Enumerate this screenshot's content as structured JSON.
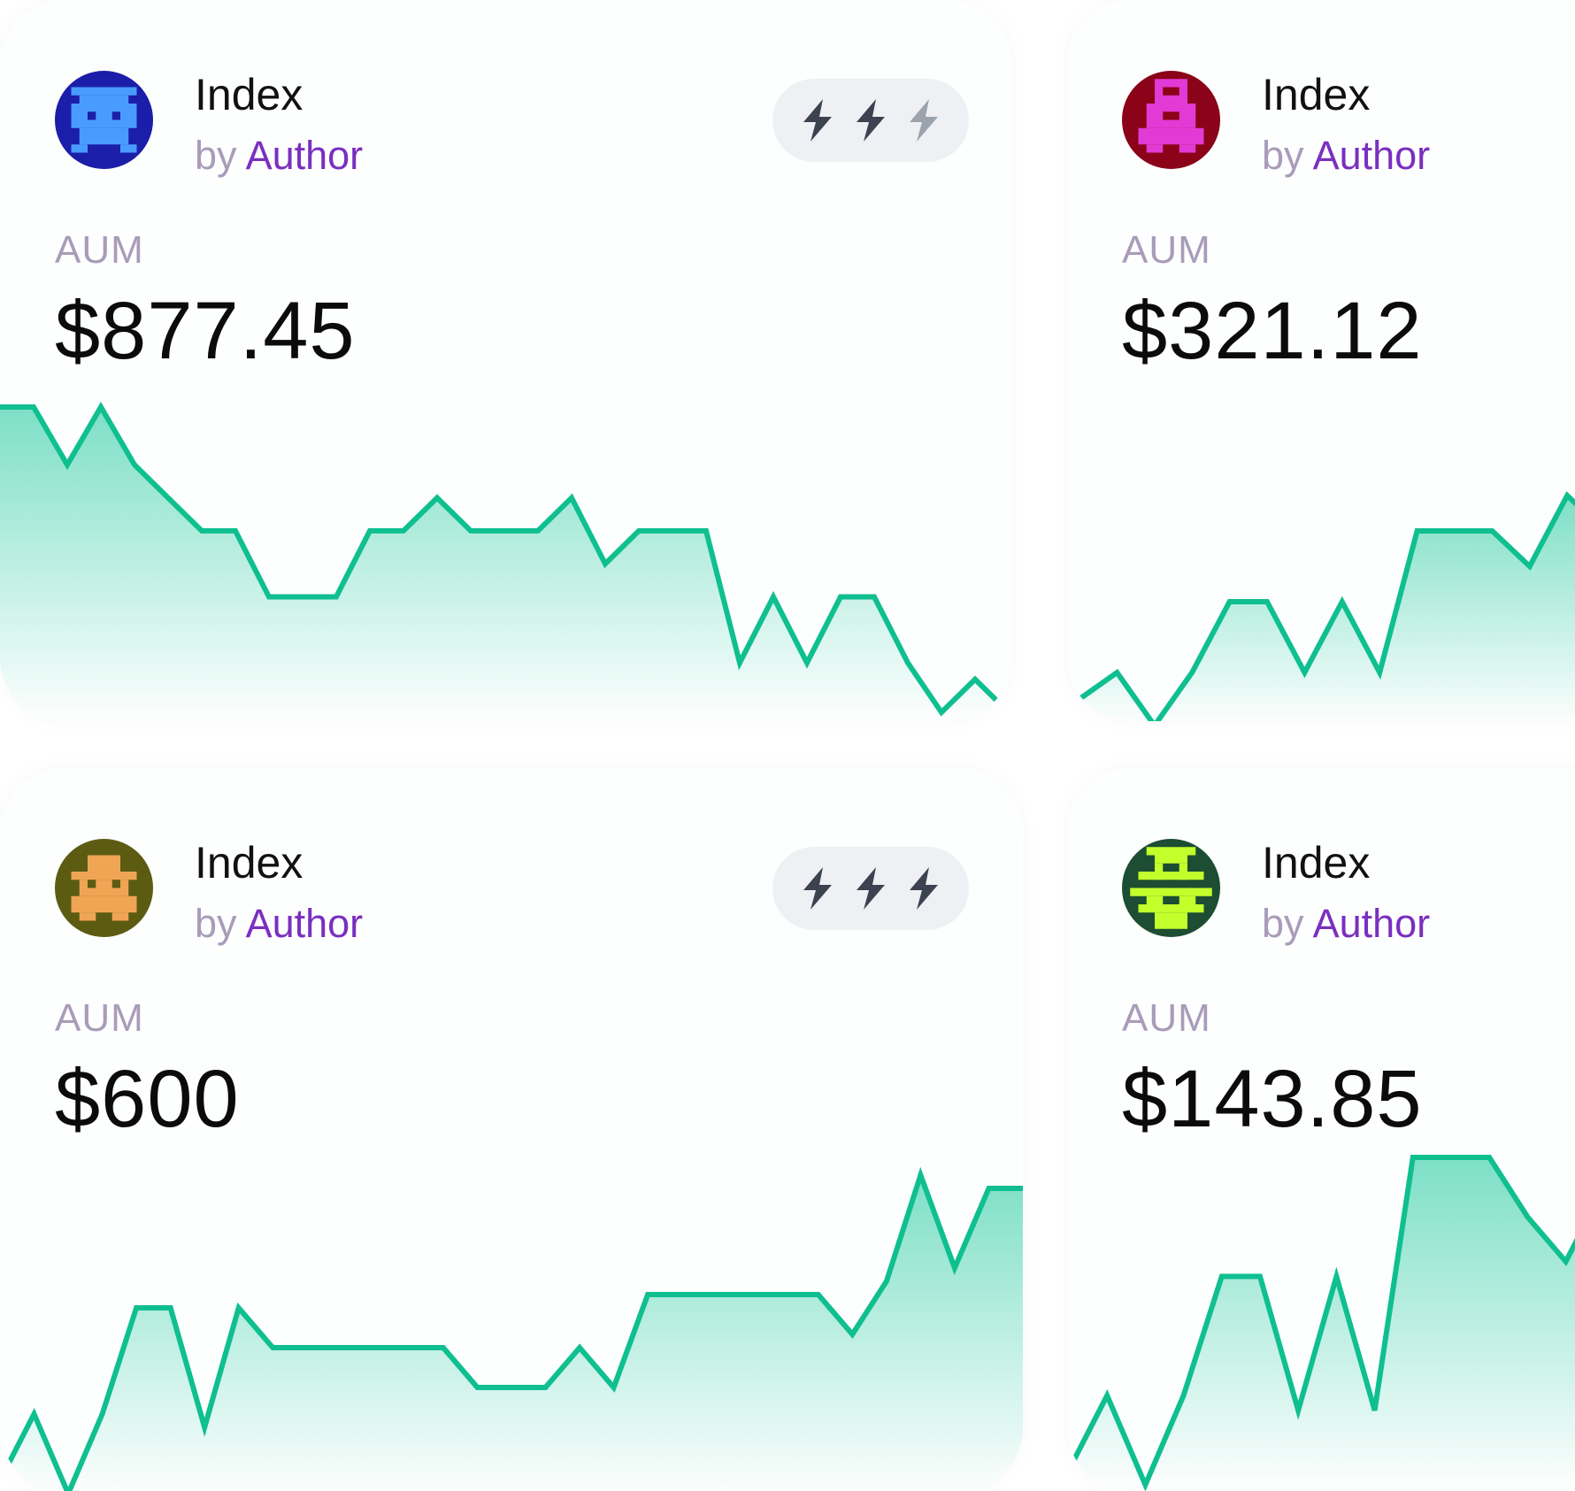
{
  "colors": {
    "accent_line": "#0fbf90",
    "accent_fill": "#6fdcc0",
    "author": "#7a2fc0",
    "muted_label": "#a99cb9",
    "badge_bg": "#eff0f4",
    "bolt_active": "#3d4250",
    "bolt_inactive": "#9ba3ad"
  },
  "cards": [
    {
      "title": "Index",
      "by": "by",
      "author": "Author",
      "aum_label": "AUM",
      "aum_value": "$877.45",
      "avatar_icon": "pixel-creature-blue-icon",
      "rating": {
        "filled": 2,
        "total": 3
      },
      "sparkline": [
        47,
        47,
        40,
        47,
        40,
        36,
        32,
        32,
        24,
        24,
        24,
        32,
        32,
        36,
        32,
        32,
        32,
        36,
        28,
        32,
        32,
        32,
        16,
        24,
        16,
        24,
        24,
        16,
        10,
        14,
        10
      ],
      "sparkline_trend": "down"
    },
    {
      "title": "Index",
      "by": "by",
      "author": "Author",
      "aum_label": "AUM",
      "aum_value": "$321.12",
      "avatar_icon": "pixel-creature-magenta-icon",
      "rating": null,
      "sparkline": [
        10,
        13,
        7,
        13,
        21,
        21,
        13,
        21,
        13,
        29,
        29,
        29,
        25,
        33,
        29,
        29
      ],
      "sparkline_trend": "up"
    },
    {
      "title": "Index",
      "by": "by",
      "author": "Author",
      "aum_label": "AUM",
      "aum_value": "$600",
      "avatar_icon": "pixel-creature-orange-icon",
      "rating": {
        "filled": 3,
        "total": 3
      },
      "sparkline": [
        9,
        14,
        8,
        14,
        22,
        22,
        13,
        22,
        19,
        19,
        19,
        19,
        19,
        19,
        16,
        16,
        16,
        19,
        16,
        23,
        23,
        23,
        23,
        23,
        23,
        20,
        24,
        32,
        25,
        31,
        31
      ],
      "sparkline_trend": "up"
    },
    {
      "title": "Index",
      "by": "by",
      "author": "Author",
      "aum_label": "AUM",
      "aum_value": "$143.85",
      "avatar_icon": "pixel-creature-lime-icon",
      "rating": null,
      "sparkline": [
        9,
        14,
        8,
        14,
        22,
        22,
        13,
        22,
        13,
        30,
        30,
        30,
        26,
        23,
        28,
        28
      ],
      "sparkline_trend": "up"
    }
  ]
}
